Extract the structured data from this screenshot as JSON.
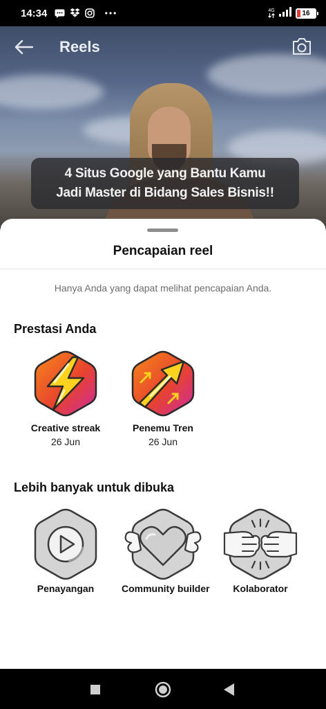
{
  "status_bar": {
    "time": "14:34",
    "network": "4G",
    "battery": "16"
  },
  "header": {
    "title": "Reels"
  },
  "video": {
    "caption": [
      "4 Situs Google yang Bantu Kamu",
      "Jadi Master di Bidang Sales Bisnis!!"
    ]
  },
  "sheet": {
    "title": "Pencapaian reel",
    "note": "Hanya Anda yang dapat melihat pencapaian Anda.",
    "earned_title": "Prestasi Anda",
    "earned": [
      {
        "name": "Creative streak",
        "date": "26 Jun",
        "icon": "lightning-badge-icon"
      },
      {
        "name": "Penemu Tren",
        "date": "26 Jun",
        "icon": "trend-arrow-badge-icon"
      }
    ],
    "locked_title": "Lebih banyak untuk dibuka",
    "locked": [
      {
        "name": "Penayangan",
        "icon": "play-badge-icon"
      },
      {
        "name": "Community builder",
        "icon": "winged-heart-badge-icon"
      },
      {
        "name": "Kolaborator",
        "icon": "fist-bump-badge-icon"
      }
    ]
  },
  "colors": {
    "badge_orange": "#f26a1b",
    "badge_magenta": "#d42e9a",
    "badge_yellow": "#ffd21f",
    "locked_gray": "#d4d4d4"
  }
}
